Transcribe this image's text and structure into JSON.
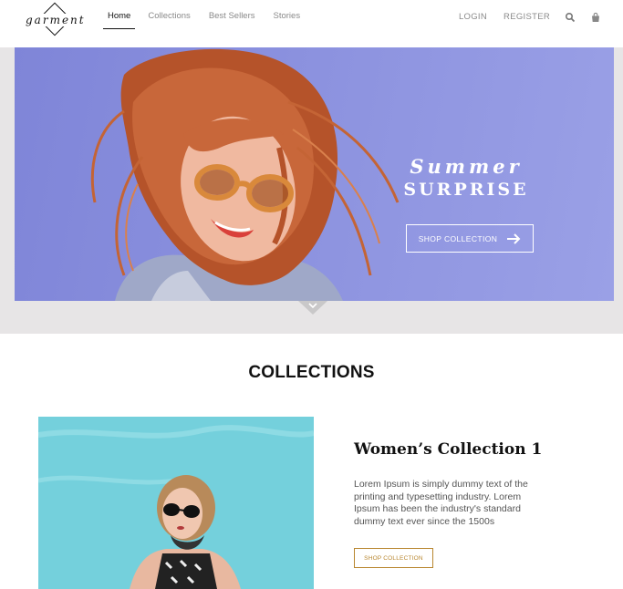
{
  "brand": {
    "logo_text": "garment"
  },
  "nav": {
    "links": [
      {
        "label": "Home",
        "active": true
      },
      {
        "label": "Collections",
        "active": false
      },
      {
        "label": "Best Sellers",
        "active": false
      },
      {
        "label": "Stories",
        "active": false
      }
    ],
    "login": "LOGIN",
    "register": "REGISTER",
    "icons": [
      "search-icon",
      "shopping-bag-icon"
    ]
  },
  "hero": {
    "title_line1": "Summer",
    "title_line2": "SURPRISE",
    "button_label": "SHOP COLLECTION",
    "button_icon": "arrow-right-icon",
    "scroll_icon": "chevron-down-icon",
    "background_color": "#8a90de"
  },
  "collections": {
    "section_title": "COLLECTIONS",
    "items": [
      {
        "title": "Women’s Collection 1",
        "description": "Lorem Ipsum is simply dummy text of the printing and typesetting industry. Lorem Ipsum has been the industry's standard dummy text ever since the 1500s",
        "button_label": "SHOP COLLECTION",
        "image_background": "#74d0dc"
      }
    ]
  },
  "colors": {
    "accent": "#b8862f",
    "band": "#e7e5e6",
    "nav_muted": "#8a8a8a"
  }
}
